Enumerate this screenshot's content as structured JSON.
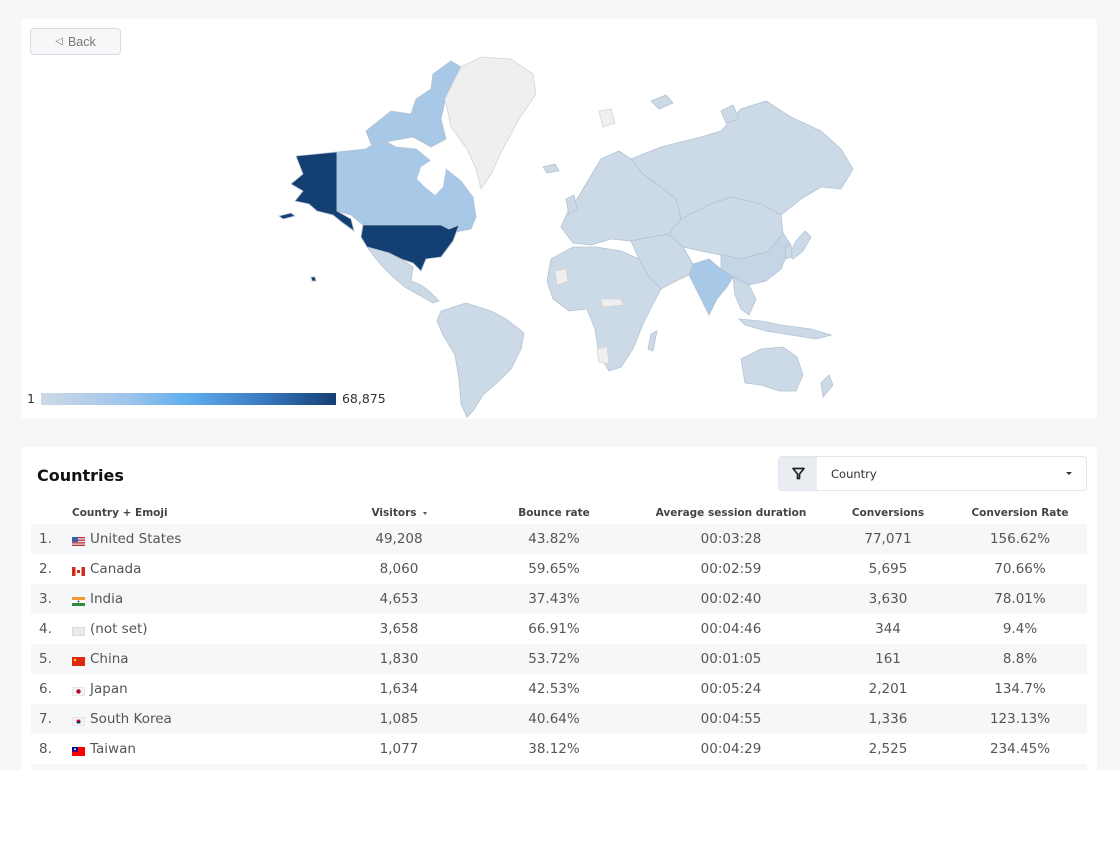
{
  "map_card": {
    "back_label": "Back",
    "legend": {
      "min_label": "1",
      "max_label": "68,875"
    },
    "colors": {
      "max": "#143f73",
      "high": "#1a4f8a",
      "mid": "#a8c8e8",
      "low": "#ccd9e6",
      "none": "#efefef",
      "border": "#b5c3d3"
    }
  },
  "table": {
    "title": "Countries",
    "filter": {
      "icon": "filter-icon",
      "selected": "Country"
    },
    "columns": [
      "Country + Emoji",
      "Visitors",
      "Bounce rate",
      "Average session duration",
      "Conversions",
      "Conversion Rate"
    ],
    "sort_column": "Visitors",
    "rows": [
      {
        "rank": "1.",
        "flag": "us",
        "country": "United States",
        "visitors": "49,208",
        "bounce": "43.82%",
        "duration": "00:03:28",
        "conversions": "77,071",
        "rate": "156.62%"
      },
      {
        "rank": "2.",
        "flag": "ca",
        "country": "Canada",
        "visitors": "8,060",
        "bounce": "59.65%",
        "duration": "00:02:59",
        "conversions": "5,695",
        "rate": "70.66%"
      },
      {
        "rank": "3.",
        "flag": "in",
        "country": "India",
        "visitors": "4,653",
        "bounce": "37.43%",
        "duration": "00:02:40",
        "conversions": "3,630",
        "rate": "78.01%"
      },
      {
        "rank": "4.",
        "flag": "white",
        "country": "(not set)",
        "visitors": "3,658",
        "bounce": "66.91%",
        "duration": "00:04:46",
        "conversions": "344",
        "rate": "9.4%"
      },
      {
        "rank": "5.",
        "flag": "cn",
        "country": "China",
        "visitors": "1,830",
        "bounce": "53.72%",
        "duration": "00:01:05",
        "conversions": "161",
        "rate": "8.8%"
      },
      {
        "rank": "6.",
        "flag": "jp",
        "country": "Japan",
        "visitors": "1,634",
        "bounce": "42.53%",
        "duration": "00:05:24",
        "conversions": "2,201",
        "rate": "134.7%"
      },
      {
        "rank": "7.",
        "flag": "kr",
        "country": "South Korea",
        "visitors": "1,085",
        "bounce": "40.64%",
        "duration": "00:04:55",
        "conversions": "1,336",
        "rate": "123.13%"
      },
      {
        "rank": "8.",
        "flag": "tw",
        "country": "Taiwan",
        "visitors": "1,077",
        "bounce": "38.12%",
        "duration": "00:04:29",
        "conversions": "2,525",
        "rate": "234.45%"
      }
    ]
  }
}
